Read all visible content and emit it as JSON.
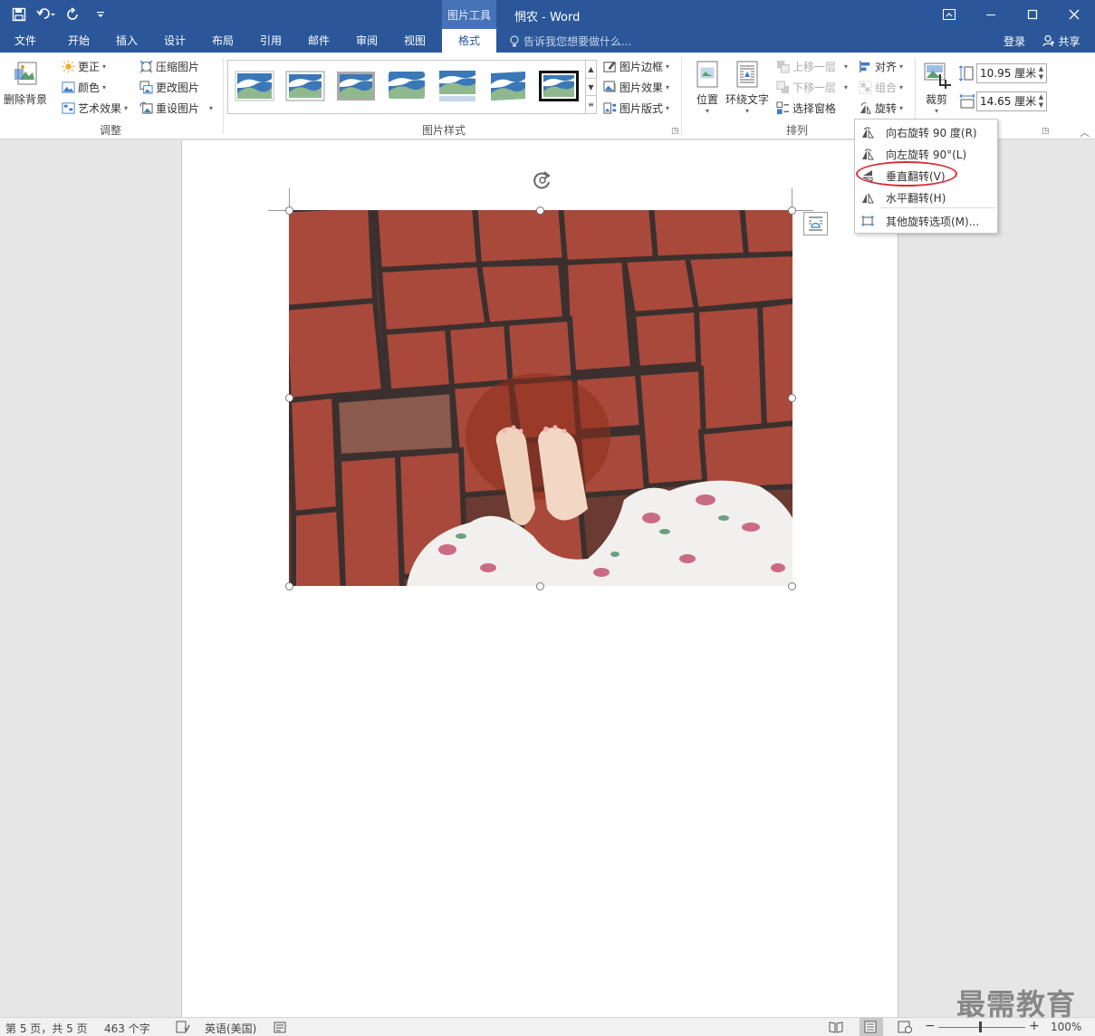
{
  "titlebar": {
    "context_tools": "图片工具",
    "doc_title": "惘农 - Word"
  },
  "tabs": [
    {
      "label": "文件"
    },
    {
      "label": "开始"
    },
    {
      "label": "插入"
    },
    {
      "label": "设计"
    },
    {
      "label": "布局"
    },
    {
      "label": "引用"
    },
    {
      "label": "邮件"
    },
    {
      "label": "审阅"
    },
    {
      "label": "视图"
    },
    {
      "label": "格式"
    }
  ],
  "tellme": "告诉我您想要做什么...",
  "account": {
    "login": "登录",
    "share": "共享"
  },
  "ribbon": {
    "adjust": {
      "remove_bg": "删除背景",
      "corrections": "更正",
      "color": "颜色",
      "artistic": "艺术效果",
      "compress": "压缩图片",
      "change": "更改图片",
      "reset": "重设图片",
      "label": "调整"
    },
    "styles": {
      "border": "图片边框",
      "effects": "图片效果",
      "layout": "图片版式",
      "label": "图片样式"
    },
    "arrange": {
      "position": "位置",
      "wrap": "环绕文字",
      "forward": "上移一层",
      "backward": "下移一层",
      "selection": "选择窗格",
      "align": "对齐",
      "group": "组合",
      "rotate": "旋转",
      "label": "排列"
    },
    "size": {
      "crop": "裁剪",
      "height": "10.95 厘米",
      "width": "14.65 厘米"
    }
  },
  "rotate_menu": {
    "items": [
      {
        "label": "向右旋转 90 度(R)"
      },
      {
        "label": "向左旋转 90°(L)"
      },
      {
        "label": "垂直翻转(V)"
      },
      {
        "label": "水平翻转(H)"
      },
      {
        "label": "其他旋转选项(M)..."
      }
    ]
  },
  "statusbar": {
    "page": "第 5 页，共 5 页",
    "words": "463 个字",
    "language": "英语(美国)",
    "zoom": "100%"
  },
  "watermark": "最需教育",
  "colors": {
    "brand": "#2b579a",
    "highlight": "#d6303a"
  }
}
